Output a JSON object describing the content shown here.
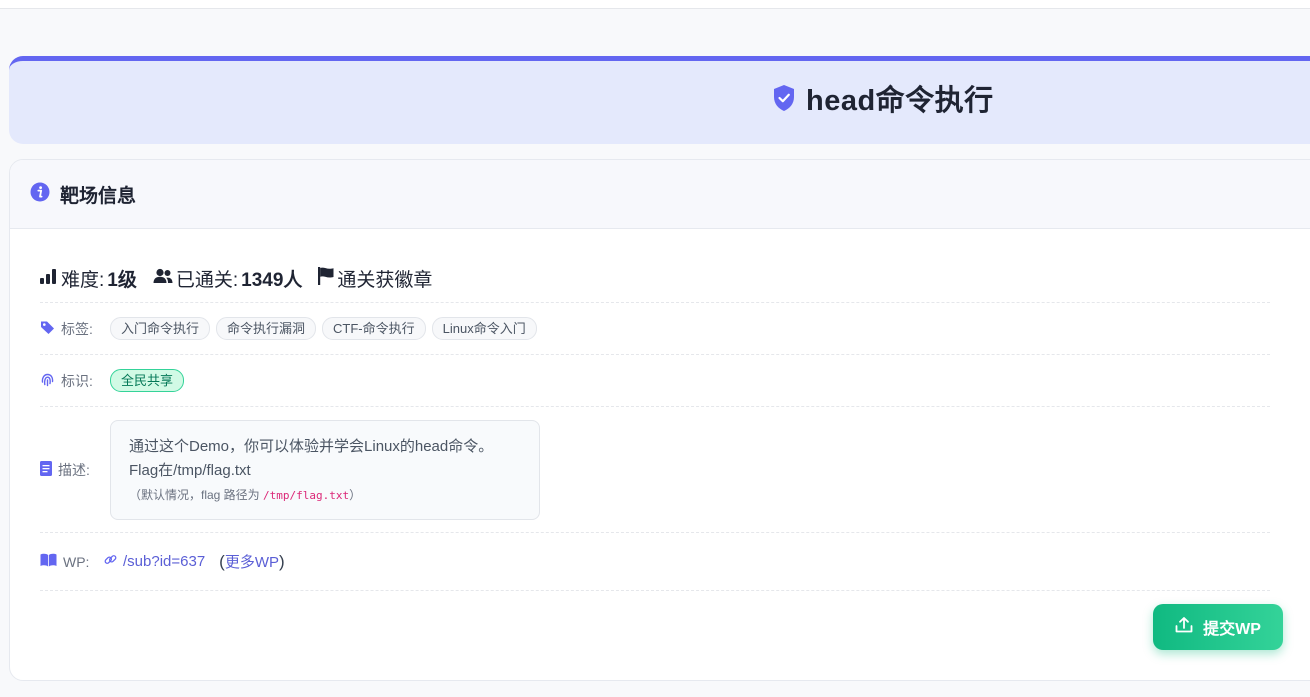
{
  "page": {
    "title": "head命令执行",
    "accent": "#6366f1"
  },
  "card": {
    "header": "靶场信息",
    "stats": {
      "difficulty_label": "难度: ",
      "difficulty_value": "1级",
      "passed_label": "已通关: ",
      "passed_value": "1349人",
      "badge_text": "通关获徽章"
    },
    "tags_label": "标签:",
    "tags": [
      "入门命令执行",
      "命令执行漏洞",
      "CTF-命令执行",
      "Linux命令入门"
    ],
    "mark_label": "标识:",
    "mark": "全民共享",
    "desc_label": "描述:",
    "desc_line1": "通过这个Demo，你可以体验并学会Linux的head命令。",
    "desc_line2": "Flag在/tmp/flag.txt",
    "desc_note_prefix": "（默认情况，flag 路径为 ",
    "desc_note_path": "/tmp/flag.txt",
    "desc_note_suffix": "）",
    "wp_label": "WP:",
    "wp_link": "/sub?id=637",
    "more_open": "(",
    "more_wp": "更多WP",
    "more_close": ")"
  },
  "submit_button": "提交WP",
  "icons": [
    "shield-check-icon",
    "info-icon",
    "signal-bars-icon",
    "users-icon",
    "flag-icon",
    "tag-icon",
    "fingerprint-icon",
    "document-icon",
    "book-icon",
    "link-icon",
    "upload-icon"
  ]
}
